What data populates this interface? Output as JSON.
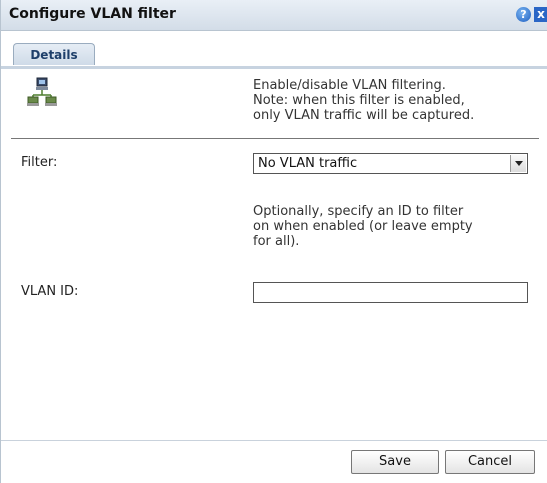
{
  "dialog": {
    "title": "Configure VLAN filter",
    "help_label": "?",
    "close_label": "x"
  },
  "tabs": [
    {
      "label": "Details"
    }
  ],
  "details": {
    "description": "Enable/disable VLAN filtering.\nNote: when this filter is enabled,\nonly VLAN traffic will be captured.",
    "filter_label": "Filter:",
    "filter_value": "No VLAN traffic",
    "id_hint": "Optionally, specify an ID to filter\non when enabled (or leave empty\nfor all).",
    "vlan_id_label": "VLAN ID:",
    "vlan_id_value": ""
  },
  "footer": {
    "save_label": "Save",
    "cancel_label": "Cancel"
  },
  "colors": {
    "title_bar": "#d3dde8",
    "tab_text": "#1e3f6a",
    "accent_blue": "#2a66c6"
  },
  "icons": {
    "network": "network-computers-icon",
    "help": "help-icon",
    "close": "close-icon"
  }
}
